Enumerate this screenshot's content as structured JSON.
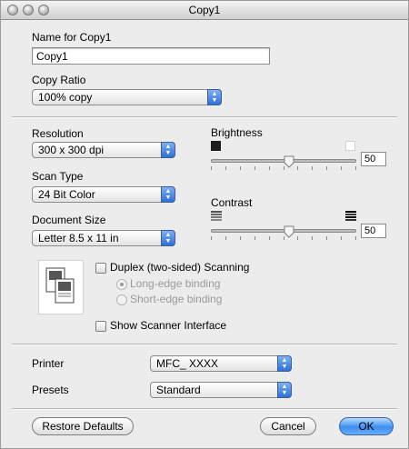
{
  "window": {
    "title": "Copy1"
  },
  "name_section": {
    "label": "Name for Copy1",
    "value": "Copy1"
  },
  "copy_ratio": {
    "label": "Copy Ratio",
    "selected": "100% copy"
  },
  "resolution": {
    "label": "Resolution",
    "selected": "300 x 300 dpi"
  },
  "scan_type": {
    "label": "Scan Type",
    "selected": "24 Bit Color"
  },
  "document_size": {
    "label": "Document Size",
    "selected": "Letter  8.5 x 11 in"
  },
  "brightness": {
    "label": "Brightness",
    "value": "50",
    "level": 0.5
  },
  "contrast": {
    "label": "Contrast",
    "value": "50",
    "level": 0.5
  },
  "duplex": {
    "label": "Duplex (two-sided) Scanning",
    "checked": false,
    "options": [
      "Long-edge binding",
      "Short-edge binding"
    ],
    "selected_index": 0
  },
  "scanner_interface": {
    "label": "Show Scanner Interface",
    "checked": false
  },
  "printer": {
    "label": "Printer",
    "selected": "MFC_ XXXX"
  },
  "presets": {
    "label": "Presets",
    "selected": "Standard"
  },
  "buttons": {
    "restore": "Restore Defaults",
    "cancel": "Cancel",
    "ok": "OK"
  },
  "colors": {
    "default_button": "#3d8ef0",
    "popup_arrow": "#2f6fd8"
  }
}
